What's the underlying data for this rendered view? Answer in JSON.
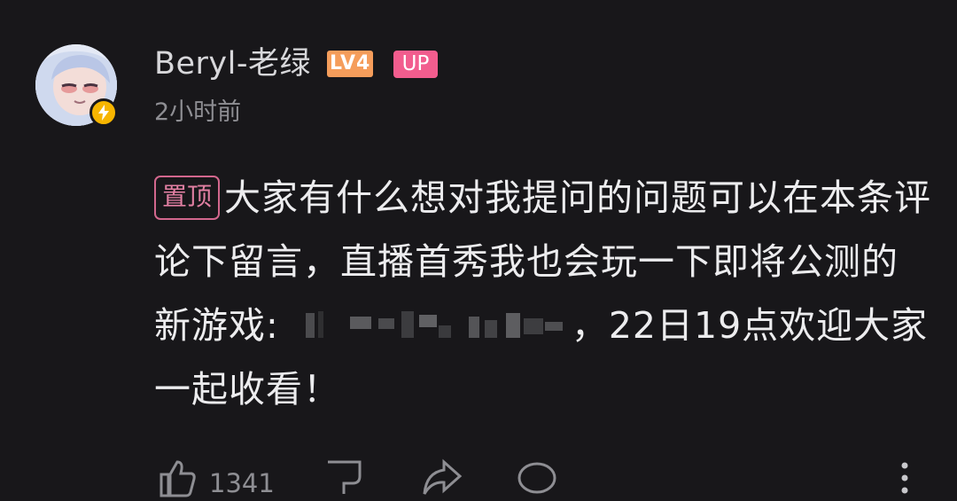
{
  "comment": {
    "username": "Beryl-老绿",
    "level": "LV4",
    "up_tag": "UP",
    "time": "2小时前",
    "pin_tag": "置顶",
    "text_part1": "大家有什么想对我提问的问题可以在本条评论下留言，直播首秀我也会玩一下即将公测的新游戏:",
    "text_part2": "，22日19点欢迎大家一起收看！"
  },
  "actions": {
    "like_count": "1341",
    "icons": [
      "thumbs-up-icon",
      "dislike-icon",
      "share-icon",
      "reply-icon",
      "more-icon"
    ]
  },
  "colors": {
    "background": "#18171a",
    "level_badge": "#f59d5b",
    "up_tag": "#f25d8e",
    "pin_tag": "#d2678d",
    "verified_badge": "#f7b500"
  }
}
